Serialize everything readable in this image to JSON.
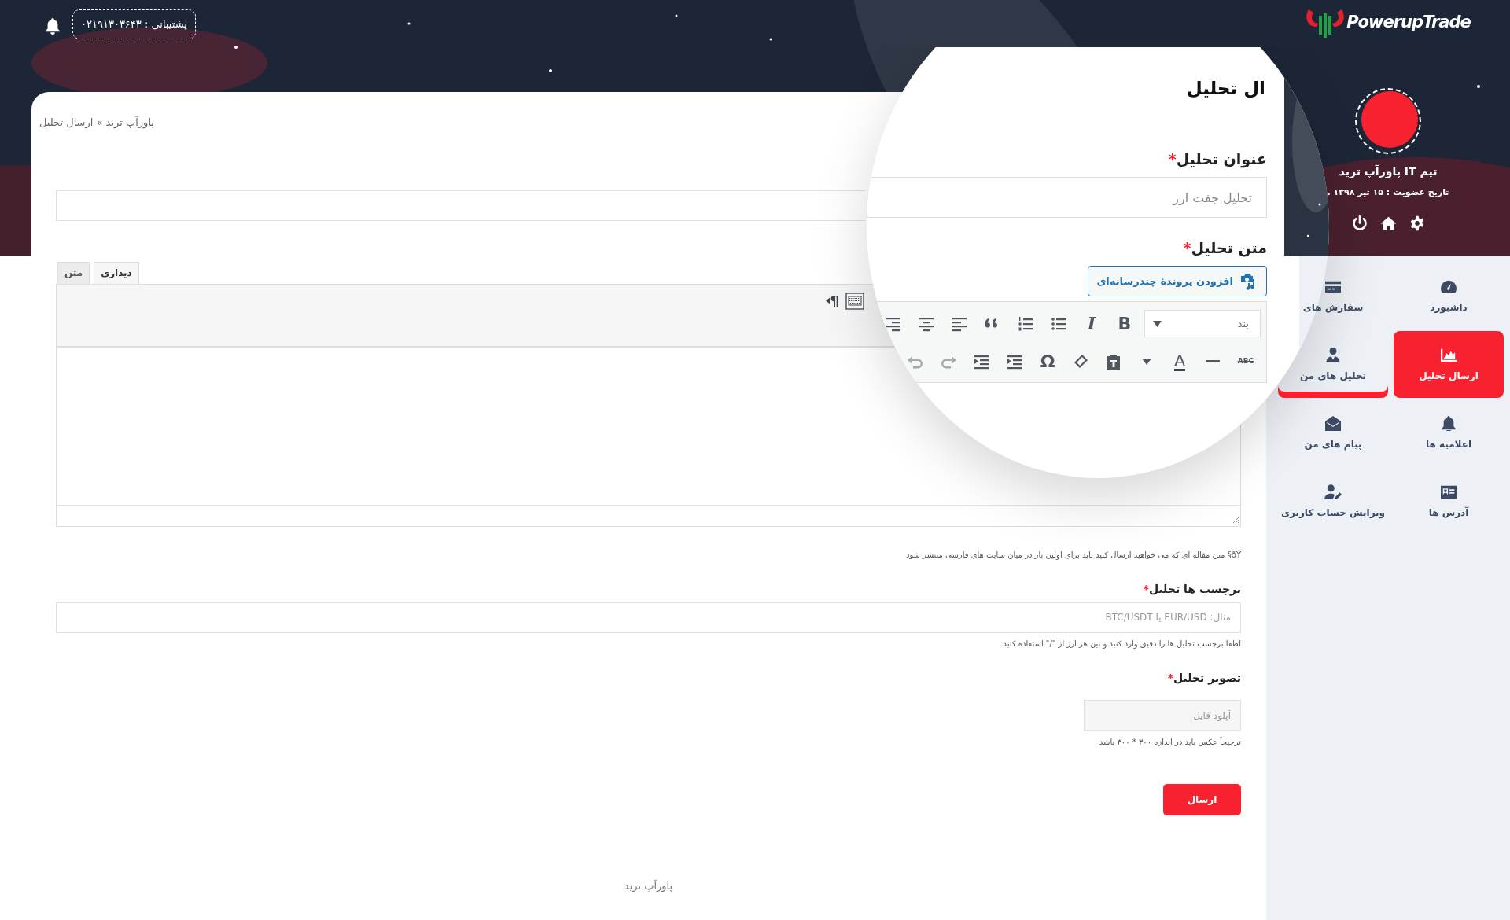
{
  "header": {
    "support": "پشتیبانی : ۰۲۱۹۱۳۰۳۶۴۳"
  },
  "logo": {
    "text": "PowerupTrade"
  },
  "profile": {
    "name": "تیم IT پاورآپ ترید",
    "member_since": "تاریخ عضویت : ۱۵ تیر ۱۳۹۸ ."
  },
  "menu": [
    {
      "label": "داشبورد",
      "selected": false,
      "underlined": false
    },
    {
      "label": "سفارش های",
      "selected": false,
      "underlined": false
    },
    {
      "label": "ارسال تحلیل",
      "selected": true,
      "underlined": false
    },
    {
      "label": "تحلیل های من",
      "selected": false,
      "underlined": true
    },
    {
      "label": "اعلامیه ها",
      "selected": false,
      "underlined": false
    },
    {
      "label": "پیام های من",
      "selected": false,
      "underlined": false
    },
    {
      "label": "آدرس ها",
      "selected": false,
      "underlined": false
    },
    {
      "label": "ویرایش حساب کاربری",
      "selected": false,
      "underlined": false
    }
  ],
  "breadcrumb": "پاورآپ ترید » ارسال تحلیل",
  "magnifier": {
    "page_title": "ال تحلیل",
    "title_field": {
      "label": "عنوان تحلیل",
      "required_mark": "*",
      "placeholder": "تحلیل جفت ارز"
    },
    "body_label": {
      "label": "متن تحلیل",
      "required_mark": "*"
    },
    "media_button": "افزودن پروندهٔ چندرسانه‌ای",
    "format_select": "بند",
    "glyphs": {
      "bold": "B",
      "italic": "I",
      "strikethrough": "ABC",
      "text_color": "A",
      "special_character": "Ω"
    }
  },
  "editor": {
    "tabs": [
      {
        "label": "دیداری",
        "selected": true
      },
      {
        "label": "متن",
        "selected": false
      }
    ],
    "paragraph_glyph": "¶",
    "note": "ðŸ§ متن مقاله ای که می خواهید ارسال کنید باید برای اولین بار در میان سایت های فارسی منتشر شود"
  },
  "tags_field": {
    "label": "برچسب ها تحلیل",
    "required_mark": "*",
    "placeholder": "مثال: EUR/USD یا BTC/USDT",
    "help": "لطفا برچسب تحلیل ها را دقیق وارد کنید و بین هر ارز از \"/\" استفاده کنید."
  },
  "image_field": {
    "label": "تصویر تحلیل",
    "required_mark": "*",
    "placeholder": "آپلود فایل",
    "help": "ترجیحاً عکس باید در اندازه ۳۰۰ * ۳۰۰ باشد"
  },
  "submit": "ارسال",
  "footer": "پاورآپ ترید"
}
